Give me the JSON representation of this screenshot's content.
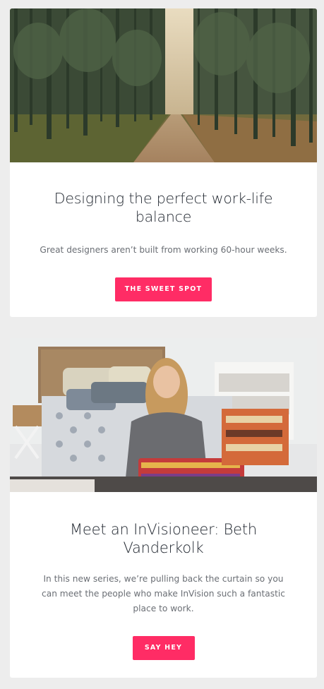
{
  "articles": [
    {
      "image": "forest-road-photo",
      "title": "Designing the perfect work-life balance",
      "summary": "Great designers aren’t built from working 60-hour weeks.",
      "cta_label": "THE SWEET SPOT"
    },
    {
      "image": "bedroom-portrait-photo",
      "title": "Meet an InVisioneer: Beth Vanderkolk",
      "summary": "In this new series, we’re pulling back the curtain so you can meet the people who make InVision such a fantastic place to work.",
      "cta_label": "SAY HEY"
    }
  ],
  "colors": {
    "background": "#ededed",
    "card": "#ffffff",
    "accent": "#ff2c65",
    "title": "#222831",
    "body_text": "#6b6f75"
  }
}
